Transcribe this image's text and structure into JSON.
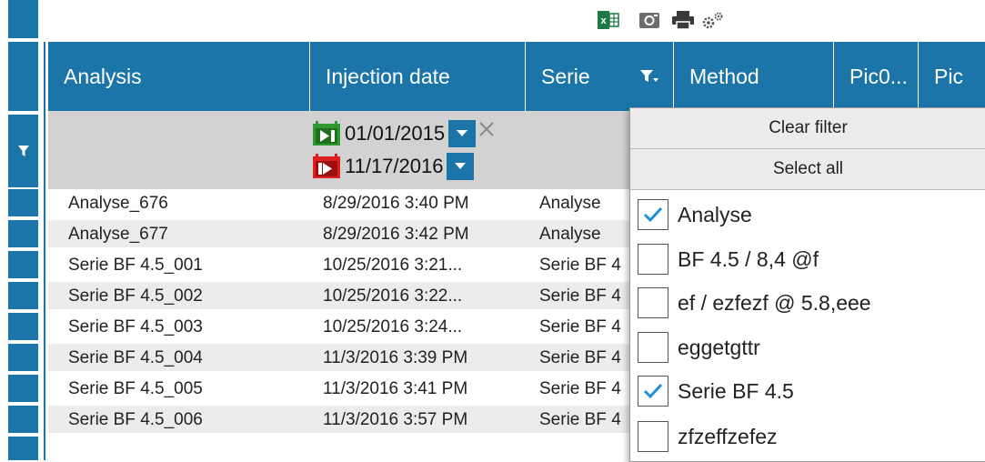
{
  "toolbar": {
    "icons": [
      "excel-export-icon",
      "camera-icon",
      "print-icon",
      "settings-gears-icon"
    ],
    "colors": {
      "excel": "#1d7a43",
      "gray": "#6d6d6d",
      "dark": "#3a3a3a"
    }
  },
  "theme": {
    "accent": "#1b75a8",
    "filter_bg": "#d2d2d2",
    "alt_row": "#ececec"
  },
  "columns": [
    {
      "label": "Analysis"
    },
    {
      "label": "Injection date"
    },
    {
      "label": "Serie"
    },
    {
      "label": "Method"
    },
    {
      "label": "Pic0..."
    },
    {
      "label": "Pic"
    }
  ],
  "filters": {
    "injection_date": {
      "from": "01/01/2015",
      "to": "11/17/2016"
    }
  },
  "rows": [
    {
      "analysis": "Analyse_676",
      "date": "8/29/2016 3:40 PM",
      "serie": "Analyse"
    },
    {
      "analysis": "Analyse_677",
      "date": "8/29/2016 3:42 PM",
      "serie": "Analyse"
    },
    {
      "analysis": "Serie BF 4.5_001",
      "date": "10/25/2016 3:21...",
      "serie": "Serie BF 4"
    },
    {
      "analysis": "Serie BF 4.5_002",
      "date": "10/25/2016 3:22...",
      "serie": "Serie BF 4"
    },
    {
      "analysis": "Serie BF 4.5_003",
      "date": "10/25/2016 3:24...",
      "serie": "Serie BF 4"
    },
    {
      "analysis": "Serie BF 4.5_004",
      "date": "11/3/2016 3:39 PM",
      "serie": "Serie BF 4"
    },
    {
      "analysis": "Serie BF 4.5_005",
      "date": "11/3/2016 3:41 PM",
      "serie": "Serie BF 4"
    },
    {
      "analysis": "Serie BF 4.5_006",
      "date": "11/3/2016 3:57 PM",
      "serie": "Serie BF 4"
    }
  ],
  "dropdown": {
    "clear_filter": "Clear filter",
    "select_all": "Select all",
    "options": [
      {
        "label": "Analyse",
        "checked": true
      },
      {
        "label": "BF 4.5 / 8,4 @f",
        "checked": false
      },
      {
        "label": "ef / ezfezf @ 5.8,eee",
        "checked": false
      },
      {
        "label": "eggetgttr",
        "checked": false
      },
      {
        "label": "Serie BF 4.5",
        "checked": true
      },
      {
        "label": "zfzeffzefez",
        "checked": false
      }
    ]
  }
}
